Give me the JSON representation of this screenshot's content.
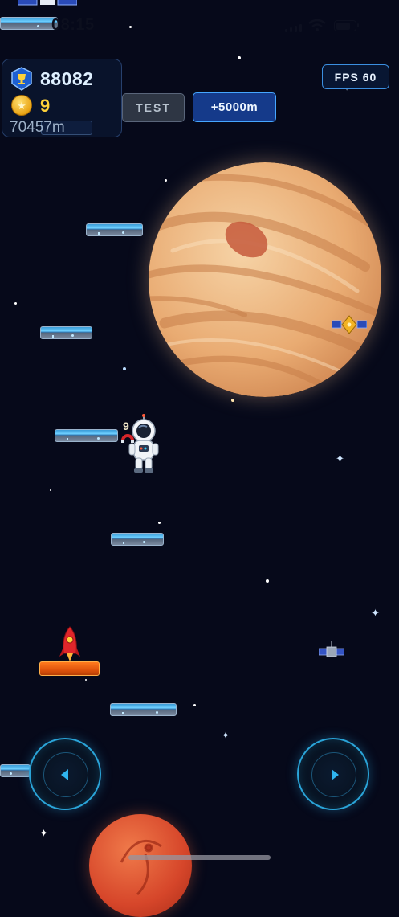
{
  "status_bar": {
    "time": "08:15",
    "icons": [
      "signal-icon",
      "wifi-icon",
      "battery-icon"
    ],
    "battery_level": 0.85
  },
  "hud": {
    "best_score": "88082",
    "coins": "9",
    "distance": "70457m",
    "icons": [
      "trophy-icon",
      "coin-icon"
    ]
  },
  "buttons": {
    "test_label": "TEST",
    "boost_label": "+5000m",
    "fps_label": "FPS 60"
  },
  "player": {
    "label": "9",
    "character": "astronaut",
    "powerup": "magnet"
  },
  "controls": {
    "left": "left-arrow",
    "right": "right-arrow"
  },
  "scene": {
    "planets": [
      "jupiter",
      "mars"
    ],
    "objects": [
      "satellite",
      "satellite",
      "satellite",
      "rocket"
    ]
  },
  "colors": {
    "background": "#06091a",
    "accent": "#2aa4d8",
    "boost": "#153a8a",
    "coin": "#ffd23a",
    "rocket_platform": "#e0540c"
  }
}
